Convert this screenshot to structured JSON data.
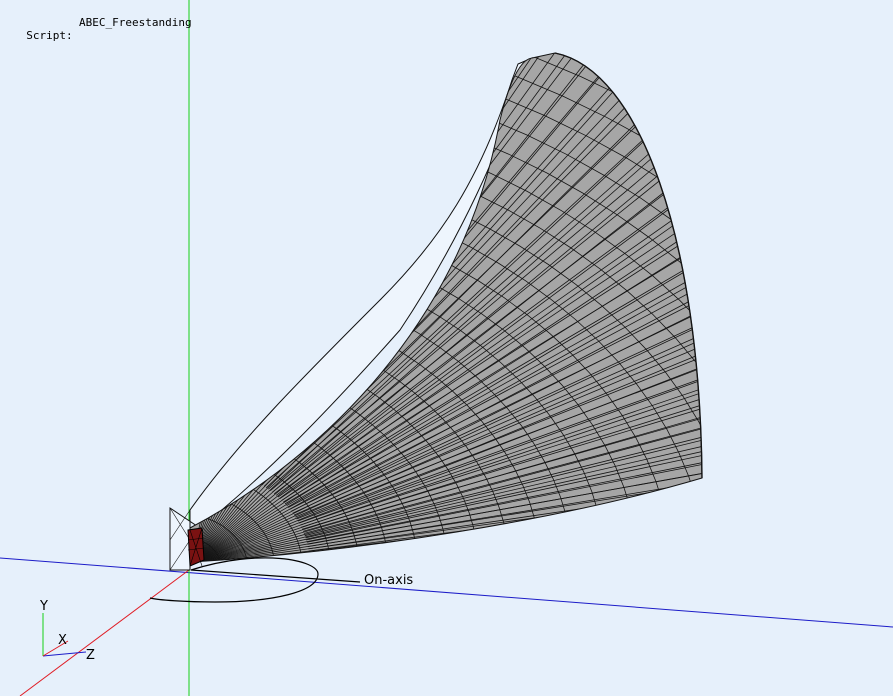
{
  "header": {
    "script_label": "Script:",
    "script_name": "ABEC_Freestanding"
  },
  "scene": {
    "on_axis_label": "On-axis",
    "triad": {
      "x": "X",
      "y": "Y",
      "z": "Z"
    },
    "colors": {
      "background": "#e6f0fb",
      "y_axis": "#17d117",
      "x_axis": "#1c1cc8",
      "z_axis": "#e01c24",
      "mesh_fill": "#a6a6a6",
      "mesh_line": "#141414",
      "source": "#7a1212"
    }
  }
}
